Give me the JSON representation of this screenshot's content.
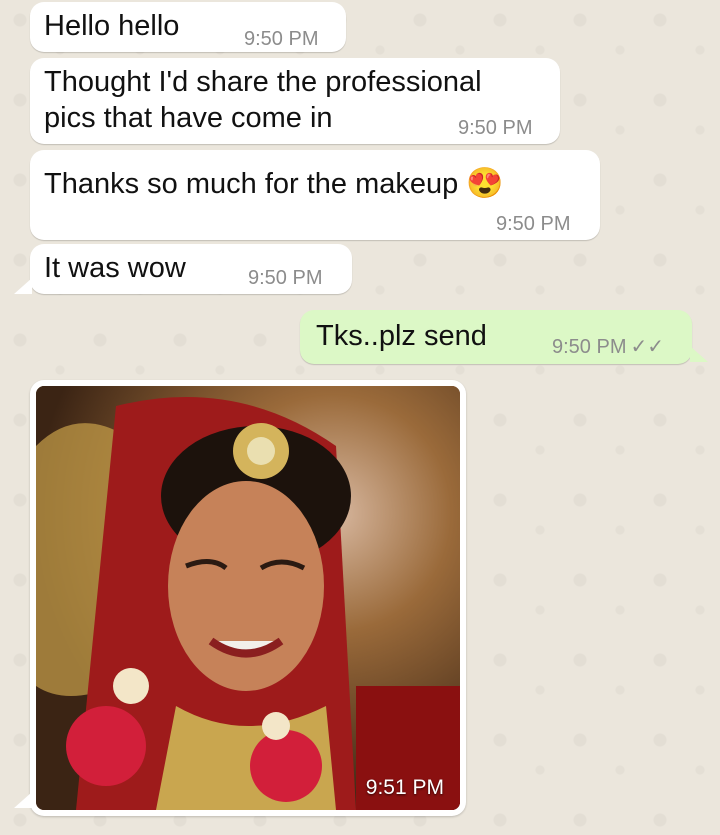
{
  "messages": [
    {
      "text": "Hello hello",
      "time": "9:50 PM"
    },
    {
      "text_line1": "Thought I'd share the professional",
      "text_line2": "pics that have come in",
      "time": "9:50 PM"
    },
    {
      "text": "Thanks so much for the makeup",
      "emoji": "😍",
      "time": "9:50 PM"
    },
    {
      "text": "It was wow",
      "time": "9:50 PM"
    },
    {
      "text": "Tks..plz send",
      "time": "9:50 PM",
      "ticks": "✓✓"
    }
  ],
  "image_message": {
    "time": "9:51 PM",
    "description_icon": "photo-of-bride"
  },
  "colors": {
    "incoming": "#ffffff",
    "outgoing": "#dcf8c6",
    "wallpaper": "#ebe6dc"
  }
}
